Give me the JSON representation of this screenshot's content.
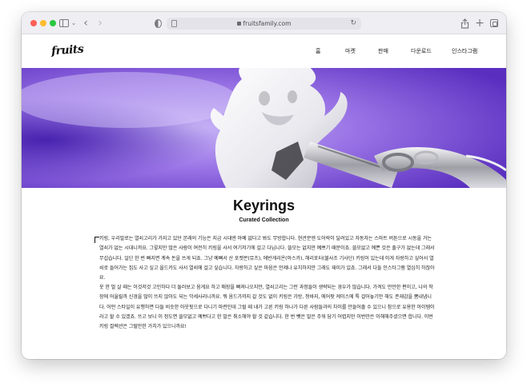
{
  "browser": {
    "url": "fruitsfamily.com"
  },
  "site": {
    "logo": "fruits",
    "nav": {
      "home": "홈",
      "market": "마켓",
      "sell": "판매",
      "download": "다운로드",
      "instagram": "인스타그램"
    }
  },
  "article": {
    "title": "Keyrings",
    "subtitle": "Curated Collection",
    "paragraphs": [
      "키링, 우리말로는 열쇠고리가 가지고 있던 본래의 기능은 지금 시대엔 아예 없다고 봐도 무방합니다. 현관문엔 도어락이 달려있고 자동차는 스마트 버튼으로 시동을 거는 열쇠가 없는 시대니까요. 그렇지만 많은 사람이 여전히 키링을 사서 여기저기에 걸고 다닙니다. 쓸모는 없지만 예쁘기 때문이죠. 쓸모없고 예쁜 것은 출구가 없는데 그래서 무섭습니다. 일단 한 번 빠지면 계속 돈을 쓰게 되죠. 그냥 예뻐서 산 포켓몬(뮤츠), 에반게리온(아스카), 해리포터(불사조 기사단) 키링이 있는데 이게 자랑하고 싶어서 열쇠로 들어가는 집도 사고 싶고 올드카도 사서 열쇠에 걸고 싶습니다. 자랑하고 싶은 마음은 언제나 유치하지만 그래도 재미가 있죠. 그래서 다들 인스타그램 열심히 하잖아요.",
      "옷 한 벌 살 때는 이것저것 고민하다 더 둘러보고 옴게요 하고 매장을 빠져나오지만, 열쇠고리는 그런 과정들이 생략되는 경우가 많습니다. 가격도 만만한 편이고, 나의 착장에 어울릴까 신경을 많이 쓰지 않아도 되는 악세사리니까요. 뭐 옴드가까지 갈 것도 없이 키링은 가방, 청바지, 에어팟 케이스에 툭 걸어놓기만 해도 존재감을 뽐내냅니다. 어떤 스타일이 유행하면 다들 비슷한 아웃핏으로 다니기 마련인데 그럴 때 내가 고른 키링 하나가 다른 사람들과의 차이를 만들어줄 수 있으니 참으로 유용한 아이템이라고 할 수 있겠죠. 쓰고 보니 이 정도면 쓸모없고 예쁘다고 한 말은 취소해야 할 것 같습니다. 한 번 뺏은 말은 주워 담기 어렵지만 이번만은 이해해주셨으면 합니다. 이번 키링 컬렉션은 그럴만한 가치가 있으니까요!"
    ]
  },
  "colors": {
    "hero_purple": "#7c56d8",
    "traffic_red": "#fe5f57",
    "traffic_yellow": "#febc2e",
    "traffic_green": "#28c840"
  }
}
